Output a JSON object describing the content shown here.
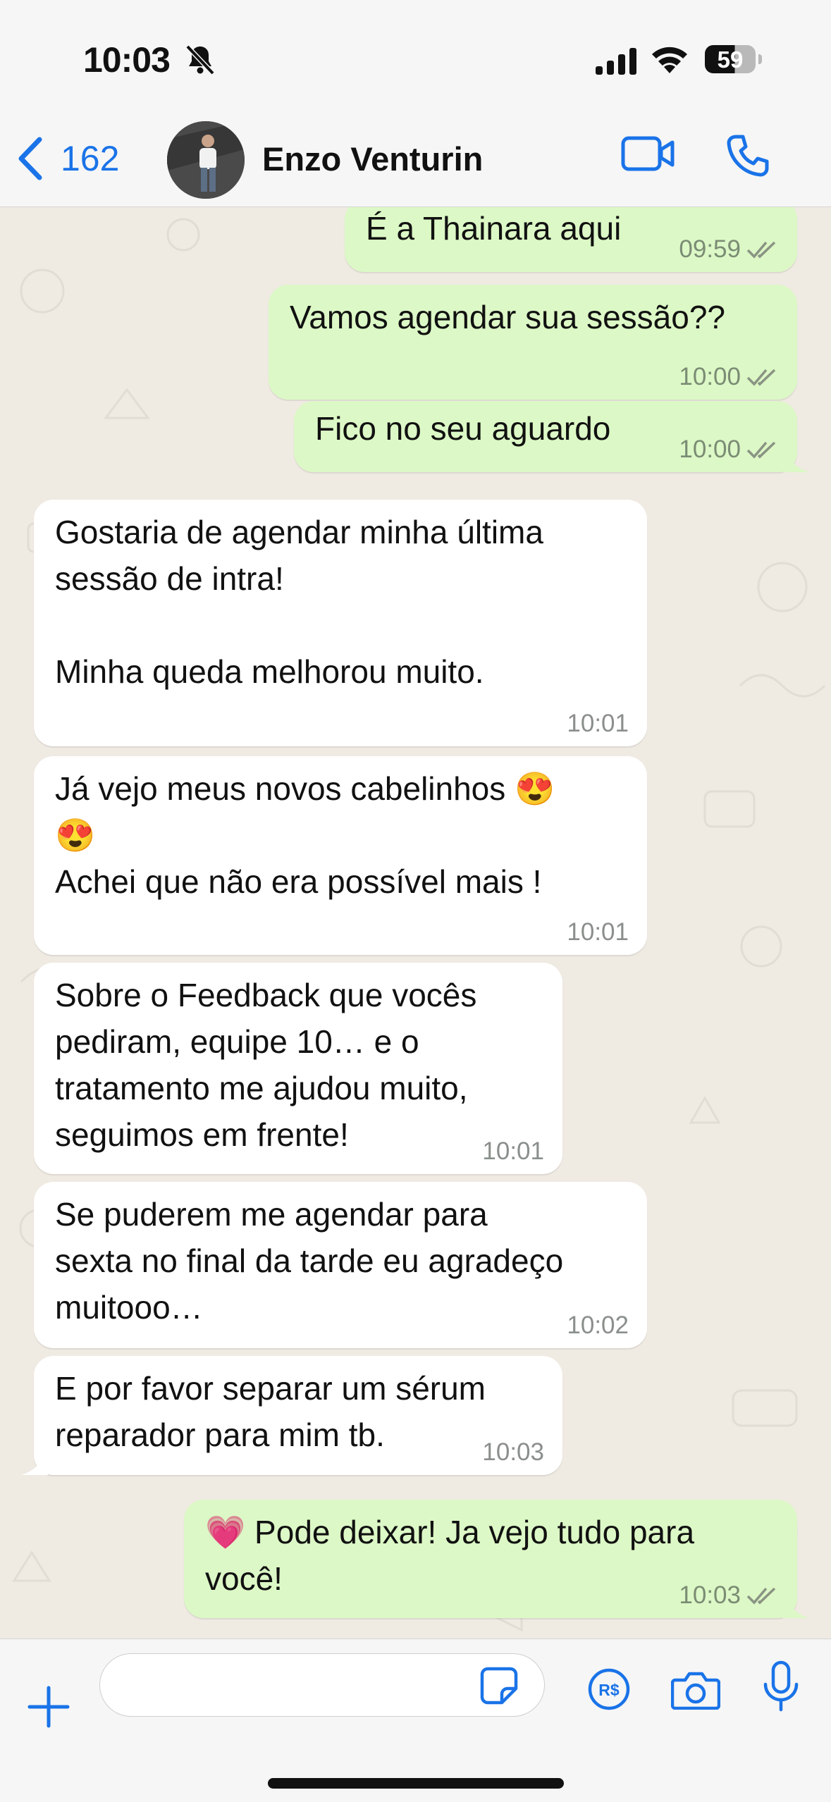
{
  "status_bar": {
    "time": "10:03",
    "battery": "59"
  },
  "header": {
    "back_count": "162",
    "contact_name": "Enzo Venturin",
    "accent_color": "#1a73e8"
  },
  "messages": [
    {
      "direction": "outgoing",
      "text": "É a Thainara aqui",
      "time": "09:59",
      "ticks": "double-check-icon"
    },
    {
      "direction": "outgoing",
      "text": "Vamos agendar sua sessão??",
      "time": "10:00",
      "ticks": "double-check-icon"
    },
    {
      "direction": "outgoing",
      "text": "Fico no seu aguardo",
      "time": "10:00",
      "ticks": "double-check-icon"
    },
    {
      "direction": "incoming",
      "text": "Gostaria de agendar minha última\nsessão de intra!\n\nMinha queda melhorou muito.",
      "time": "10:01"
    },
    {
      "direction": "incoming",
      "text": "Já vejo meus novos cabelinhos 😍\n😍\nAchei que não era possível mais !",
      "time": "10:01"
    },
    {
      "direction": "incoming",
      "text": "Sobre o Feedback que vocês\npediram, equipe 10… e o\ntratamento me ajudou muito,\nseguimos em frente!",
      "time": "10:01"
    },
    {
      "direction": "incoming",
      "text": "Se puderem me agendar para\nsexta no final da tarde eu agradeço\nmuitooo…",
      "time": "10:02"
    },
    {
      "direction": "incoming",
      "text": "E por favor separar um sérum\nreparador para mim tb.",
      "time": "10:03"
    },
    {
      "direction": "outgoing",
      "text": "💗 Pode deixar! Ja vejo tudo para\nvocê!",
      "time": "10:03",
      "ticks": "double-check-icon"
    }
  ],
  "composer": {
    "placeholder": ""
  },
  "colors": {
    "outgoing_bubble": "#dcf8c6",
    "incoming_bubble": "#ffffff",
    "chat_background": "#efeae2"
  }
}
